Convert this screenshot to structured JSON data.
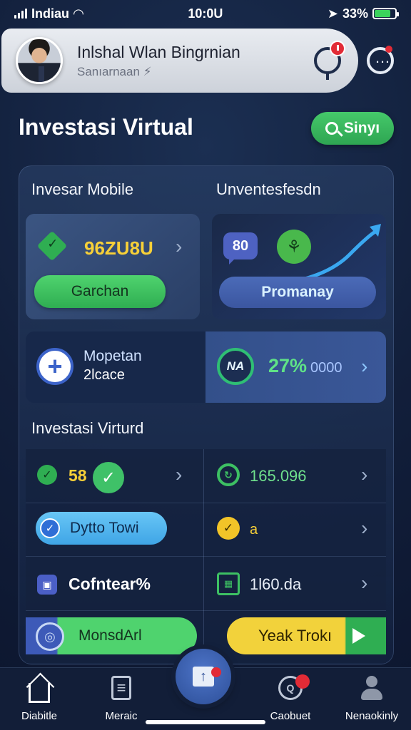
{
  "status_bar": {
    "carrier": "Indiau",
    "time": "10:0U",
    "battery": "33%",
    "battery_level_pct": 80
  },
  "profile": {
    "name": "Inlshal Wlan Bingrnian",
    "subtitle": "Sanıarnaan ⚡",
    "icons": [
      "avatar",
      "bell-icon",
      "message-icon"
    ]
  },
  "page": {
    "title": "Investasi Virtual",
    "search_label": "Sinyı"
  },
  "sections": {
    "top_left_label": "Invesar Mobile",
    "top_right_label": "Unventesfesdn",
    "middle_label": "Investasi Virturd"
  },
  "card_a": {
    "value": "96ZU8U",
    "button": "Garchan"
  },
  "card_b": {
    "badge": "80",
    "plant_symbol": "⚘",
    "button": "Promanay"
  },
  "card_c": {
    "title": "Mopetan",
    "subtitle": "2lcace"
  },
  "card_d": {
    "badge": "NA",
    "percent": "27%",
    "value": "0000"
  },
  "grid": {
    "r1_left_value": "58",
    "r1_right_value": "165.096",
    "r2_left_pill": "Dytto Towi",
    "r2_right_value": "a",
    "r3_left_value": "Cofntear%",
    "r3_right_value": "1l60.da",
    "r4_left_pill": "MonsdArl",
    "r4_right_pill": "Yeak Trokı"
  },
  "nav": {
    "items": [
      {
        "label": "Diabitle",
        "icon": "home-icon"
      },
      {
        "label": "Meraic",
        "icon": "document-icon"
      },
      {
        "label": "",
        "icon": "center-action-icon"
      },
      {
        "label": "Caobuet",
        "icon": "chat-icon"
      },
      {
        "label": "Nenaokinly",
        "icon": "user-icon"
      }
    ]
  },
  "colors": {
    "background": "#121f3b",
    "accent_green": "#2fae52",
    "accent_yellow": "#f7d038",
    "accent_blue": "#3b56a0",
    "alert_red": "#e22b36"
  }
}
